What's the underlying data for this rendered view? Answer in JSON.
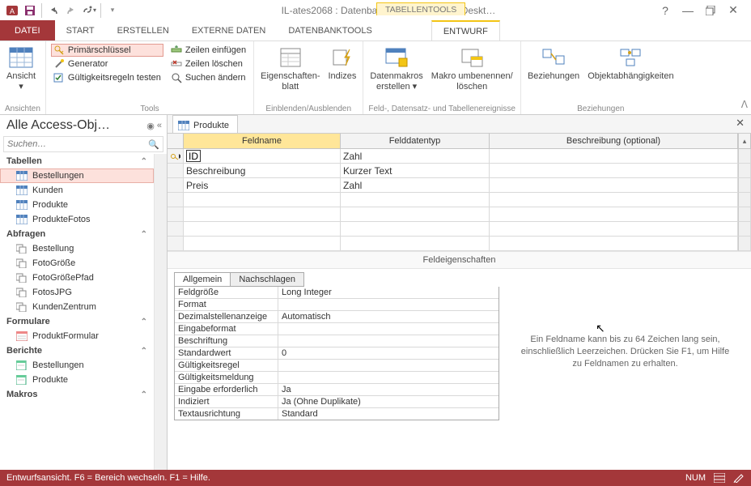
{
  "title_bar": {
    "app_title": "IL-ates2068 : Datenbank- C:\\Users\\user4\\Deskt…",
    "tools_title": "TABELLENTOOLS"
  },
  "ribbon_tabs": {
    "file": "DATEI",
    "start": "START",
    "create": "ERSTELLEN",
    "external": "EXTERNE DATEN",
    "dbtools": "DATENBANKTOOLS",
    "design": "ENTWURF"
  },
  "ribbon": {
    "views": {
      "btn": "Ansicht",
      "group": "Ansichten"
    },
    "tools": {
      "pk": "Primärschlüssel",
      "gen": "Generator",
      "test": "Gültigkeitsregeln testen",
      "ins": "Zeilen einfügen",
      "del": "Zeilen löschen",
      "find": "Suchen ändern",
      "group": "Tools"
    },
    "showhide": {
      "propsheet": "Eigenschaften-\nblatt",
      "indices": "Indizes",
      "group": "Einblenden/Ausblenden"
    },
    "events": {
      "datamac": "Datenmakros\nerstellen ▾",
      "rename": "Makro umbenennen/\nlöschen",
      "group": "Feld-, Datensatz- und Tabellenereignisse"
    },
    "rel": {
      "rel": "Beziehungen",
      "dep": "Objektabhängigkeiten",
      "group": "Beziehungen"
    }
  },
  "nav": {
    "title": "Alle Access-Obj…",
    "search_ph": "Suchen…",
    "cat_tables": "Tabellen",
    "cat_queries": "Abfragen",
    "cat_forms": "Formulare",
    "cat_reports": "Berichte",
    "cat_macros": "Makros",
    "tables": [
      "Bestellungen",
      "Kunden",
      "Produkte",
      "ProdukteFotos"
    ],
    "queries": [
      "Bestellung",
      "FotoGröße",
      "FotoGrößePfad",
      "FotosJPG",
      "KundenZentrum"
    ],
    "forms": [
      "ProduktFormular"
    ],
    "reports": [
      "Bestellungen",
      "Produkte"
    ]
  },
  "doc_tab": "Produkte",
  "grid": {
    "h_field": "Feldname",
    "h_type": "Felddatentyp",
    "h_desc": "Beschreibung (optional)",
    "rows": [
      {
        "name": "ID",
        "type": "Zahl",
        "pk": true
      },
      {
        "name": "Beschreibung",
        "type": "Kurzer Text",
        "pk": false
      },
      {
        "name": "Preis",
        "type": "Zahl",
        "pk": false
      }
    ]
  },
  "props": {
    "title": "Feldeigenschaften",
    "tab_general": "Allgemein",
    "tab_lookup": "Nachschlagen",
    "rows": [
      {
        "n": "Feldgröße",
        "v": "Long Integer"
      },
      {
        "n": "Format",
        "v": ""
      },
      {
        "n": "Dezimalstellenanzeige",
        "v": "Automatisch"
      },
      {
        "n": "Eingabeformat",
        "v": ""
      },
      {
        "n": "Beschriftung",
        "v": ""
      },
      {
        "n": "Standardwert",
        "v": "0"
      },
      {
        "n": "Gültigkeitsregel",
        "v": ""
      },
      {
        "n": "Gültigkeitsmeldung",
        "v": ""
      },
      {
        "n": "Eingabe erforderlich",
        "v": "Ja"
      },
      {
        "n": "Indiziert",
        "v": "Ja (Ohne Duplikate)"
      },
      {
        "n": "Textausrichtung",
        "v": "Standard"
      }
    ],
    "hint": "Ein Feldname kann bis zu 64 Zeichen lang sein, einschließlich Leerzeichen. Drücken Sie F1, um Hilfe zu Feldnamen zu erhalten."
  },
  "status": {
    "left": "Entwurfsansicht. F6 = Bereich wechseln. F1 = Hilfe.",
    "num": "NUM"
  }
}
